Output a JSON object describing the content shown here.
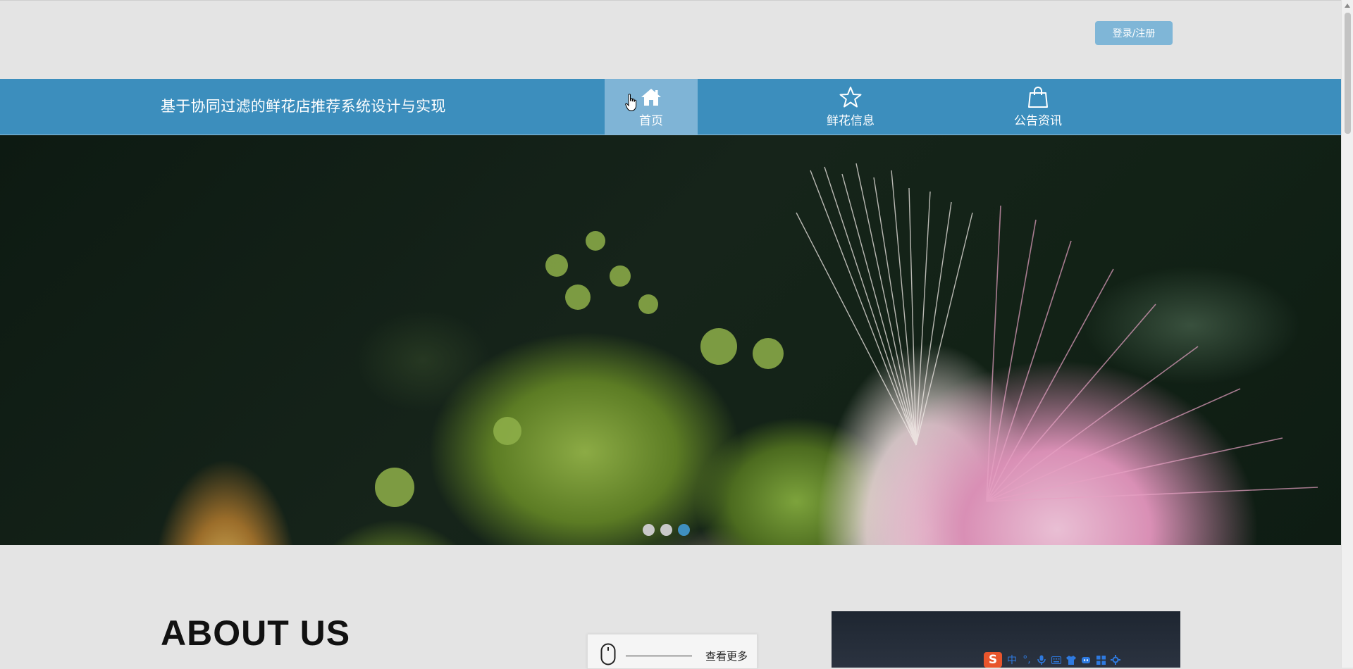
{
  "header": {
    "login_button": "登录/注册",
    "site_title": "基于协同过滤的鲜花店推荐系统设计与实现"
  },
  "nav": {
    "items": [
      {
        "label": "首页",
        "icon": "home-icon",
        "active": true
      },
      {
        "label": "鲜花信息",
        "icon": "star-icon",
        "active": false
      },
      {
        "label": "公告资讯",
        "icon": "shopping-bag-icon",
        "active": false
      }
    ]
  },
  "carousel": {
    "slide_count": 3,
    "active_index": 2
  },
  "about": {
    "heading": "ABOUT US",
    "more_label": "查看更多"
  },
  "ime_toolbar": {
    "logo": "S",
    "mode": "中",
    "punct": "°,"
  },
  "colors": {
    "nav_background": "#3c8ebd",
    "nav_active": "#7fb4d6",
    "login_button": "#7fb6d7",
    "dot_active": "#3f8fc0"
  }
}
